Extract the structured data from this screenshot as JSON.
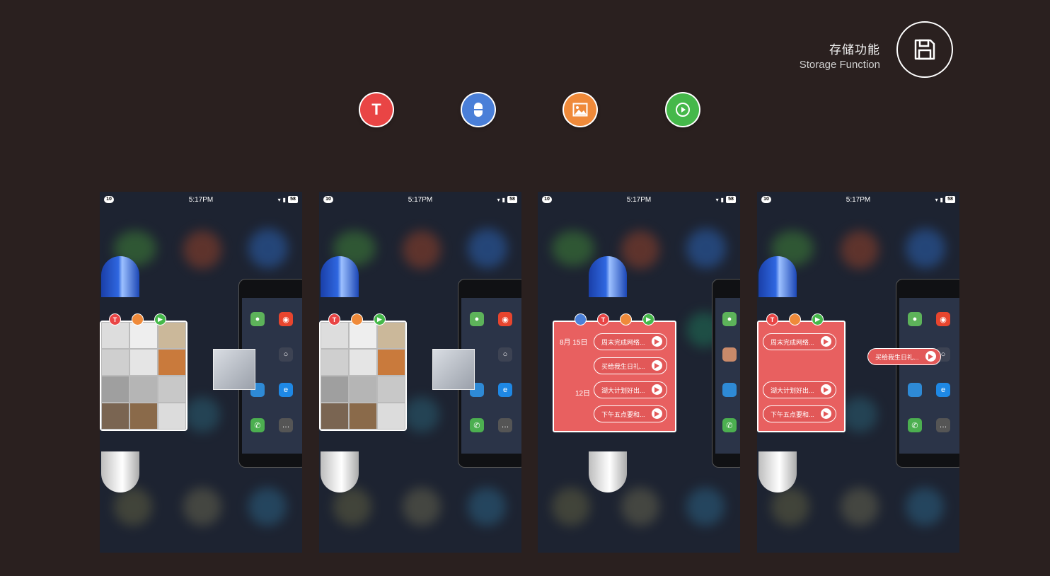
{
  "header": {
    "title_cn": "存储功能",
    "title_en": "Storage Function",
    "save_icon": "floppy-disk-icon"
  },
  "type_buttons": [
    {
      "name": "text",
      "label": "T",
      "color": "#e94545",
      "icon": "text-icon"
    },
    {
      "name": "voice",
      "label": "",
      "color": "#4a7fd8",
      "icon": "capsule-icon"
    },
    {
      "name": "image",
      "label": "",
      "color": "#ef8a3a",
      "icon": "image-icon"
    },
    {
      "name": "video",
      "label": "",
      "color": "#45b84a",
      "icon": "play-icon"
    }
  ],
  "status_bar": {
    "time": "5:17PM",
    "badge": "10",
    "battery": "58"
  },
  "notes": {
    "date_main": "8月 15日",
    "date_second": "12日",
    "items": [
      "周末完成网络...",
      "买给我生日礼...",
      "湖大计划好出...",
      "下午五点要和..."
    ]
  },
  "colors": {
    "background": "#2a201f",
    "note_red": "#e86060",
    "capsule_blue": "#2f67e0"
  }
}
